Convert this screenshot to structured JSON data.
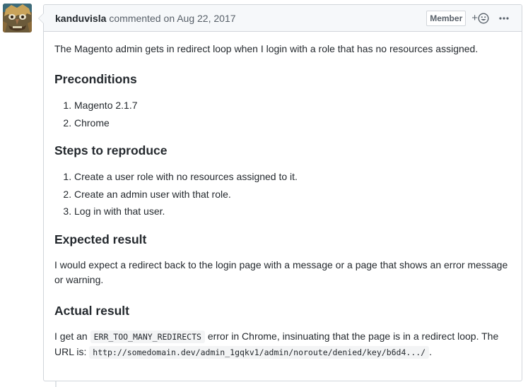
{
  "comment": {
    "author": "kanduvisla",
    "action": "commented",
    "timestamp": "on Aug 22, 2017",
    "badge": "Member",
    "reaction_plus": "+",
    "body": {
      "intro": "The Magento admin gets in redirect loop when I login with a role that has no resources assigned.",
      "preconditions_heading": "Preconditions",
      "preconditions": [
        "Magento 2.1.7",
        "Chrome"
      ],
      "steps_heading": "Steps to reproduce",
      "steps": [
        "Create a user role with no resources assigned to it.",
        "Create an admin user with that role.",
        "Log in with that user."
      ],
      "expected_heading": "Expected result",
      "expected_line1": "I would expect a redirect back to the login page with a message or a page that shows an error message",
      "expected_line2": "or warning.",
      "actual_heading": "Actual result",
      "actual_prefix": "I get an",
      "actual_code1": "ERR_TOO_MANY_REDIRECTS",
      "actual_mid": "error in Chrome, insinuating that the page is in a redirect loop. The",
      "actual_url_prefix": "URL is:",
      "actual_code2": "http://somedomain.dev/admin_1gqkv1/admin/noroute/denied/key/b6d4.../",
      "actual_suffix": "."
    }
  },
  "icons": {
    "avatar": "avatar-image",
    "smiley": "smiley-icon",
    "more": "kebab-horizontal-icon"
  },
  "colors": {
    "header_bg": "#f6f8fa",
    "border": "#d1d5da",
    "text": "#24292e",
    "muted": "#586069"
  }
}
